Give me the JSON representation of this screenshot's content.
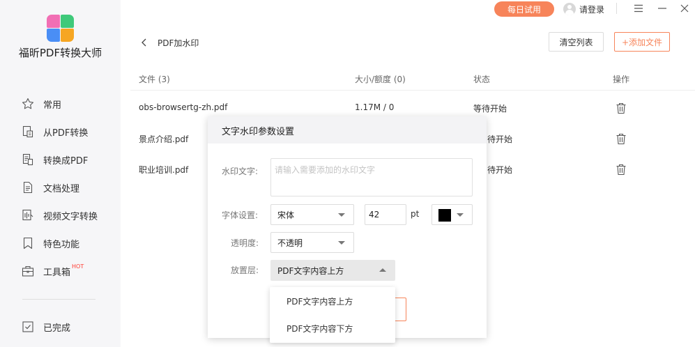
{
  "app": {
    "name": "福昕PDF转换大师"
  },
  "topbar": {
    "trial_label": "每日试用",
    "login_label": "请登录"
  },
  "sidebar": {
    "items": [
      {
        "label": "常用",
        "icon": "star-icon"
      },
      {
        "label": "从PDF转换",
        "icon": "from-pdf-icon"
      },
      {
        "label": "转换成PDF",
        "icon": "to-pdf-icon"
      },
      {
        "label": "文档处理",
        "icon": "document-icon"
      },
      {
        "label": "视频文字转换",
        "icon": "video-text-icon"
      },
      {
        "label": "特色功能",
        "icon": "bookmark-icon"
      },
      {
        "label": "工具箱",
        "icon": "toolbox-icon",
        "badge": "HOT"
      }
    ],
    "done_label": "已完成"
  },
  "header": {
    "title": "PDF加水印",
    "clear_label": "清空列表",
    "add_label": "+添加文件"
  },
  "table": {
    "columns": [
      "文件 (3)",
      "大小/额度 (0)",
      "状态",
      "操作"
    ],
    "rows": [
      {
        "name": "obs-browsertg-zh.pdf",
        "size": "1.17M / 0",
        "status": "等待开始"
      },
      {
        "name": "景点介绍.pdf",
        "size": "",
        "status": "等待开始"
      },
      {
        "name": "职业培训.pdf",
        "size": "",
        "status": "等待开始"
      }
    ],
    "visible_status_partial": [
      "待开始",
      "待开始"
    ]
  },
  "dialog": {
    "title": "文字水印参数设置",
    "watermark_text_label": "水印文字:",
    "watermark_text_placeholder": "请输入需要添加的水印文字",
    "font_label": "字体设置:",
    "font_value": "宋体",
    "font_size": "42",
    "font_size_unit": "pt",
    "font_color": "#000000",
    "opacity_label": "透明度:",
    "opacity_value": "不透明",
    "layer_label": "放置层:",
    "layer_value": "PDF文字内容上方",
    "layer_options": [
      "PDF文字内容上方",
      "PDF文字内容下方"
    ]
  },
  "colors": {
    "accent": "#f7845a",
    "sidebar_bg": "#f6f6f8"
  }
}
